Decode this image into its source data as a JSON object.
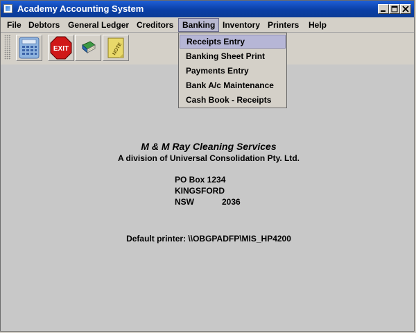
{
  "window": {
    "title": "Academy Accounting System"
  },
  "menubar": {
    "items": [
      {
        "label": "File"
      },
      {
        "label": "Debtors"
      },
      {
        "label": "General Ledger"
      },
      {
        "label": "Creditors"
      },
      {
        "label": "Banking",
        "active": true
      },
      {
        "label": "Inventory"
      },
      {
        "label": "Printers"
      },
      {
        "label": "Help"
      }
    ]
  },
  "toolbar": {
    "buttons": [
      {
        "icon": "calculator-icon"
      },
      {
        "icon": "exit-icon",
        "label": "EXIT"
      },
      {
        "icon": "book-icon"
      },
      {
        "icon": "note-icon",
        "label": "NOTE"
      }
    ]
  },
  "banking_menu": {
    "items": [
      {
        "label": "Receipts Entry",
        "selected": true
      },
      {
        "label": "Banking Sheet Print"
      },
      {
        "label": "Payments Entry"
      },
      {
        "label": "Bank A/c Maintenance"
      },
      {
        "label": "Cash Book - Receipts"
      }
    ]
  },
  "company": {
    "name": "M & M Ray Cleaning Services",
    "division": "A division of Universal Consolidation Pty. Ltd.",
    "address_line1": "PO Box 1234",
    "address_line2": "KINGSFORD",
    "state": "NSW",
    "postcode": "2036"
  },
  "printer": {
    "default_text": "Default printer: \\\\OBGPADFP\\MIS_HP4200"
  }
}
